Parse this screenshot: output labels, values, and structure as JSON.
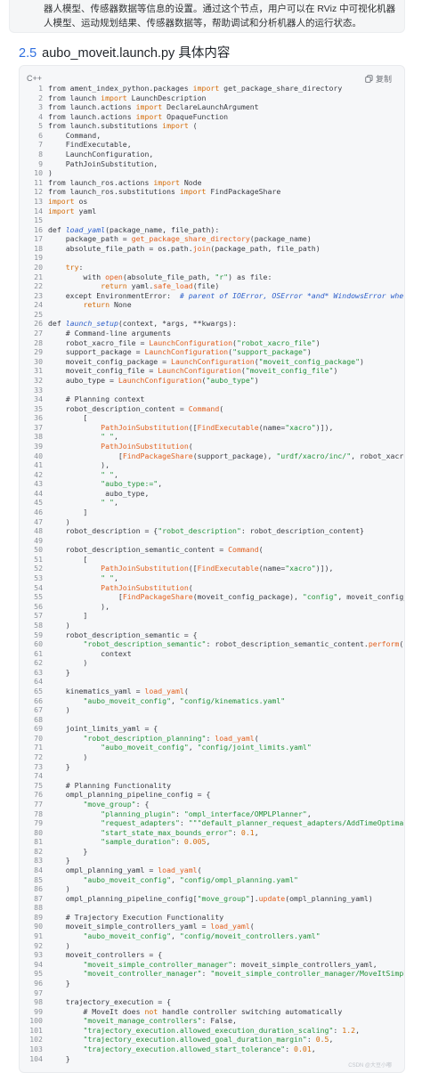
{
  "intro": {
    "text": "器人模型、传感器数据等信息的设置。通过这个节点，用户可以在 RViz 中可视化机器人模型、运动规划结果、传感器数据等，帮助调试和分析机器人的运行状态。"
  },
  "section": {
    "number": "2.5",
    "title": "aubo_moveit.launch.py 具体内容"
  },
  "code_block": {
    "language": "C++",
    "copy_label": "复制",
    "lines": [
      [
        [
          "from ament_index_python.packages ",
          ""
        ],
        [
          "import",
          "kw"
        ],
        [
          " get_package_share_directory",
          ""
        ]
      ],
      [
        [
          "from launch ",
          ""
        ],
        [
          "import",
          "kw"
        ],
        [
          " LaunchDescription",
          ""
        ]
      ],
      [
        [
          "from launch.actions ",
          ""
        ],
        [
          "import",
          "kw"
        ],
        [
          " DeclareLaunchArgument",
          ""
        ]
      ],
      [
        [
          "from launch.actions ",
          ""
        ],
        [
          "import",
          "kw"
        ],
        [
          " OpaqueFunction",
          ""
        ]
      ],
      [
        [
          "from launch.substitutions ",
          ""
        ],
        [
          "import",
          "kw"
        ],
        [
          " (",
          ""
        ]
      ],
      [
        [
          "    Command,",
          ""
        ]
      ],
      [
        [
          "    FindExecutable,",
          ""
        ]
      ],
      [
        [
          "    LaunchConfiguration,",
          ""
        ]
      ],
      [
        [
          "    PathJoinSubstitution,",
          ""
        ]
      ],
      [
        [
          ")",
          ""
        ]
      ],
      [
        [
          "from launch_ros.actions ",
          ""
        ],
        [
          "import",
          "kw"
        ],
        [
          " Node",
          ""
        ]
      ],
      [
        [
          "from launch_ros.substitutions ",
          ""
        ],
        [
          "import",
          "kw"
        ],
        [
          " FindPackageShare",
          ""
        ]
      ],
      [
        [
          "import",
          "kw"
        ],
        [
          " os",
          ""
        ]
      ],
      [
        [
          "import",
          "kw"
        ],
        [
          " yaml",
          ""
        ]
      ],
      [
        [
          "",
          ""
        ]
      ],
      [
        [
          "def ",
          ""
        ],
        [
          "load_yaml",
          "cm"
        ],
        [
          "(package_name, file_path):",
          ""
        ]
      ],
      [
        [
          "    package_path = ",
          ""
        ],
        [
          "get_package_share_directory",
          "fn"
        ],
        [
          "(package_name)",
          ""
        ]
      ],
      [
        [
          "    absolute_file_path = os.path.",
          ""
        ],
        [
          "join",
          "fn"
        ],
        [
          "(package_path, file_path)",
          ""
        ]
      ],
      [
        [
          "",
          ""
        ]
      ],
      [
        [
          "    ",
          ""
        ],
        [
          "try",
          "kw"
        ],
        [
          ":",
          ""
        ]
      ],
      [
        [
          "        with ",
          ""
        ],
        [
          "open",
          "fn"
        ],
        [
          "(absolute_file_path, ",
          ""
        ],
        [
          "\"r\"",
          "st"
        ],
        [
          ") as file:",
          ""
        ]
      ],
      [
        [
          "            ",
          ""
        ],
        [
          "return",
          "kw"
        ],
        [
          " yaml.",
          ""
        ],
        [
          "safe_load",
          "fn"
        ],
        [
          "(file)",
          ""
        ]
      ],
      [
        [
          "    except EnvironmentError:  ",
          ""
        ],
        [
          "# parent of IOError, OSError *and* WindowsError where available",
          "cm"
        ]
      ],
      [
        [
          "        ",
          ""
        ],
        [
          "return",
          "kw"
        ],
        [
          " None",
          ""
        ]
      ],
      [
        [
          "",
          ""
        ]
      ],
      [
        [
          "def ",
          ""
        ],
        [
          "launch_setup",
          "cm"
        ],
        [
          "(context, *args, **kwargs):",
          ""
        ]
      ],
      [
        [
          "    # Command-line arguments",
          ""
        ]
      ],
      [
        [
          "    robot_xacro_file = ",
          ""
        ],
        [
          "LaunchConfiguration",
          "fn"
        ],
        [
          "(",
          ""
        ],
        [
          "\"robot_xacro_file\"",
          "st"
        ],
        [
          ")",
          ""
        ]
      ],
      [
        [
          "    support_package = ",
          ""
        ],
        [
          "LaunchConfiguration",
          "fn"
        ],
        [
          "(",
          ""
        ],
        [
          "\"support_package\"",
          "st"
        ],
        [
          ")",
          ""
        ]
      ],
      [
        [
          "    moveit_config_package = ",
          ""
        ],
        [
          "LaunchConfiguration",
          "fn"
        ],
        [
          "(",
          ""
        ],
        [
          "\"moveit_config_package\"",
          "st"
        ],
        [
          ")",
          ""
        ]
      ],
      [
        [
          "    moveit_config_file = ",
          ""
        ],
        [
          "LaunchConfiguration",
          "fn"
        ],
        [
          "(",
          ""
        ],
        [
          "\"moveit_config_file\"",
          "st"
        ],
        [
          ")",
          ""
        ]
      ],
      [
        [
          "    aubo_type = ",
          ""
        ],
        [
          "LaunchConfiguration",
          "fn"
        ],
        [
          "(",
          ""
        ],
        [
          "\"aubo_type\"",
          "st"
        ],
        [
          ")",
          ""
        ]
      ],
      [
        [
          "",
          ""
        ]
      ],
      [
        [
          "    # Planning context",
          ""
        ]
      ],
      [
        [
          "    robot_description_content = ",
          ""
        ],
        [
          "Command",
          "fn"
        ],
        [
          "(",
          ""
        ]
      ],
      [
        [
          "        [",
          ""
        ]
      ],
      [
        [
          "            ",
          ""
        ],
        [
          "PathJoinSubstitution",
          "fn"
        ],
        [
          "([",
          ""
        ],
        [
          "FindExecutable",
          "fn"
        ],
        [
          "(name=",
          ""
        ],
        [
          "\"xacro\"",
          "st"
        ],
        [
          ")]),",
          ""
        ]
      ],
      [
        [
          "            ",
          ""
        ],
        [
          "\" \"",
          "st"
        ],
        [
          ",",
          ""
        ]
      ],
      [
        [
          "            ",
          ""
        ],
        [
          "PathJoinSubstitution",
          "fn"
        ],
        [
          "(",
          ""
        ]
      ],
      [
        [
          "                [",
          ""
        ],
        [
          "FindPackageShare",
          "fn"
        ],
        [
          "(support_package), ",
          ""
        ],
        [
          "\"urdf/xacro/inc/\"",
          "st"
        ],
        [
          ", robot_xacro_file]",
          ""
        ]
      ],
      [
        [
          "            ),",
          ""
        ]
      ],
      [
        [
          "            ",
          ""
        ],
        [
          "\" \"",
          "st"
        ],
        [
          ",",
          ""
        ]
      ],
      [
        [
          "            ",
          ""
        ],
        [
          "\"aubo_type:=\"",
          "st"
        ],
        [
          ",",
          ""
        ]
      ],
      [
        [
          "             aubo_type,",
          ""
        ]
      ],
      [
        [
          "            ",
          ""
        ],
        [
          "\" \"",
          "st"
        ],
        [
          ",",
          ""
        ]
      ],
      [
        [
          "        ]",
          ""
        ]
      ],
      [
        [
          "    )",
          ""
        ]
      ],
      [
        [
          "    robot_description = {",
          ""
        ],
        [
          "\"robot_description\"",
          "st"
        ],
        [
          ": robot_description_content}",
          ""
        ]
      ],
      [
        [
          "",
          ""
        ]
      ],
      [
        [
          "    robot_description_semantic_content = ",
          ""
        ],
        [
          "Command",
          "fn"
        ],
        [
          "(",
          ""
        ]
      ],
      [
        [
          "        [",
          ""
        ]
      ],
      [
        [
          "            ",
          ""
        ],
        [
          "PathJoinSubstitution",
          "fn"
        ],
        [
          "([",
          ""
        ],
        [
          "FindExecutable",
          "fn"
        ],
        [
          "(name=",
          ""
        ],
        [
          "\"xacro\"",
          "st"
        ],
        [
          ")]),",
          ""
        ]
      ],
      [
        [
          "            ",
          ""
        ],
        [
          "\" \"",
          "st"
        ],
        [
          ",",
          ""
        ]
      ],
      [
        [
          "            ",
          ""
        ],
        [
          "PathJoinSubstitution",
          "fn"
        ],
        [
          "(",
          ""
        ]
      ],
      [
        [
          "                [",
          ""
        ],
        [
          "FindPackageShare",
          "fn"
        ],
        [
          "(moveit_config_package), ",
          ""
        ],
        [
          "\"config\"",
          "st"
        ],
        [
          ", moveit_config_file]",
          ""
        ]
      ],
      [
        [
          "            ),",
          ""
        ]
      ],
      [
        [
          "        ]",
          ""
        ]
      ],
      [
        [
          "    )",
          ""
        ]
      ],
      [
        [
          "    robot_description_semantic = {",
          ""
        ]
      ],
      [
        [
          "        ",
          ""
        ],
        [
          "\"robot_description_semantic\"",
          "st"
        ],
        [
          ": robot_description_semantic_content.",
          ""
        ],
        [
          "perform",
          "fn"
        ],
        [
          "(",
          ""
        ]
      ],
      [
        [
          "            context",
          ""
        ]
      ],
      [
        [
          "        )",
          ""
        ]
      ],
      [
        [
          "    }",
          ""
        ]
      ],
      [
        [
          "",
          ""
        ]
      ],
      [
        [
          "    kinematics_yaml = ",
          ""
        ],
        [
          "load_yaml",
          "fn"
        ],
        [
          "(",
          ""
        ]
      ],
      [
        [
          "        ",
          ""
        ],
        [
          "\"aubo_moveit_config\"",
          "st"
        ],
        [
          ", ",
          ""
        ],
        [
          "\"config/kinematics.yaml\"",
          "st"
        ]
      ],
      [
        [
          "    )",
          ""
        ]
      ],
      [
        [
          "",
          ""
        ]
      ],
      [
        [
          "    joint_limits_yaml = {",
          ""
        ]
      ],
      [
        [
          "        ",
          ""
        ],
        [
          "\"robot_description_planning\"",
          "st"
        ],
        [
          ": ",
          ""
        ],
        [
          "load_yaml",
          "fn"
        ],
        [
          "(",
          ""
        ]
      ],
      [
        [
          "            ",
          ""
        ],
        [
          "\"aubo_moveit_config\"",
          "st"
        ],
        [
          ", ",
          ""
        ],
        [
          "\"config/joint_limits.yaml\"",
          "st"
        ]
      ],
      [
        [
          "        )",
          ""
        ]
      ],
      [
        [
          "    }",
          ""
        ]
      ],
      [
        [
          "",
          ""
        ]
      ],
      [
        [
          "    # Planning Functionality",
          ""
        ]
      ],
      [
        [
          "    ompl_planning_pipeline_config = {",
          ""
        ]
      ],
      [
        [
          "        ",
          ""
        ],
        [
          "\"move_group\"",
          "st"
        ],
        [
          ": {",
          ""
        ]
      ],
      [
        [
          "            ",
          ""
        ],
        [
          "\"planning_plugin\"",
          "st"
        ],
        [
          ": ",
          ""
        ],
        [
          "\"ompl_interface/OMPLPlanner\"",
          "st"
        ],
        [
          ",",
          ""
        ]
      ],
      [
        [
          "            ",
          ""
        ],
        [
          "\"request_adapters\"",
          "st"
        ],
        [
          ": ",
          ""
        ],
        [
          "\"\"\"default_planner_request_adapters/AddTimeOptimalParameterizat",
          "st"
        ]
      ],
      [
        [
          "            ",
          ""
        ],
        [
          "\"start_state_max_bounds_error\"",
          "st"
        ],
        [
          ": ",
          ""
        ],
        [
          "0.1",
          "nu"
        ],
        [
          ",",
          ""
        ]
      ],
      [
        [
          "            ",
          ""
        ],
        [
          "\"sample_duration\"",
          "st"
        ],
        [
          ": ",
          ""
        ],
        [
          "0.005",
          "nu"
        ],
        [
          ",",
          ""
        ]
      ],
      [
        [
          "        }",
          ""
        ]
      ],
      [
        [
          "    }",
          ""
        ]
      ],
      [
        [
          "    ompl_planning_yaml = ",
          ""
        ],
        [
          "load_yaml",
          "fn"
        ],
        [
          "(",
          ""
        ]
      ],
      [
        [
          "        ",
          ""
        ],
        [
          "\"aubo_moveit_config\"",
          "st"
        ],
        [
          ", ",
          ""
        ],
        [
          "\"config/ompl_planning.yaml\"",
          "st"
        ]
      ],
      [
        [
          "    )",
          ""
        ]
      ],
      [
        [
          "    ompl_planning_pipeline_config[",
          ""
        ],
        [
          "\"move_group\"",
          "st"
        ],
        [
          "].",
          ""
        ],
        [
          "update",
          "fn"
        ],
        [
          "(ompl_planning_yaml)",
          ""
        ]
      ],
      [
        [
          "",
          ""
        ]
      ],
      [
        [
          "    # Trajectory Execution Functionality",
          ""
        ]
      ],
      [
        [
          "    moveit_simple_controllers_yaml = ",
          ""
        ],
        [
          "load_yaml",
          "fn"
        ],
        [
          "(",
          ""
        ]
      ],
      [
        [
          "        ",
          ""
        ],
        [
          "\"aubo_moveit_config\"",
          "st"
        ],
        [
          ", ",
          ""
        ],
        [
          "\"config/moveit_controllers.yaml\"",
          "st"
        ]
      ],
      [
        [
          "    )",
          ""
        ]
      ],
      [
        [
          "    moveit_controllers = {",
          ""
        ]
      ],
      [
        [
          "        ",
          ""
        ],
        [
          "\"moveit_simple_controller_manager\"",
          "st"
        ],
        [
          ": moveit_simple_controllers_yaml,",
          ""
        ]
      ],
      [
        [
          "        ",
          ""
        ],
        [
          "\"moveit_controller_manager\"",
          "st"
        ],
        [
          ": ",
          ""
        ],
        [
          "\"moveit_simple_controller_manager/MoveItSimpleControllerMa",
          "st"
        ]
      ],
      [
        [
          "    }",
          ""
        ]
      ],
      [
        [
          "",
          ""
        ]
      ],
      [
        [
          "    trajectory_execution = {",
          ""
        ]
      ],
      [
        [
          "        # MoveIt does ",
          ""
        ],
        [
          "not",
          "kw"
        ],
        [
          " handle controller switching automatically",
          ""
        ]
      ],
      [
        [
          "        ",
          ""
        ],
        [
          "\"moveit_manage_controllers\"",
          "st"
        ],
        [
          ": False,",
          ""
        ]
      ],
      [
        [
          "        ",
          ""
        ],
        [
          "\"trajectory_execution.allowed_execution_duration_scaling\"",
          "st"
        ],
        [
          ": ",
          ""
        ],
        [
          "1.2",
          "nu"
        ],
        [
          ",",
          ""
        ]
      ],
      [
        [
          "        ",
          ""
        ],
        [
          "\"trajectory_execution.allowed_goal_duration_margin\"",
          "st"
        ],
        [
          ": ",
          ""
        ],
        [
          "0.5",
          "nu"
        ],
        [
          ",",
          ""
        ]
      ],
      [
        [
          "        ",
          ""
        ],
        [
          "\"trajectory_execution.allowed_start_tolerance\"",
          "st"
        ],
        [
          ": ",
          ""
        ],
        [
          "0.01",
          "nu"
        ],
        [
          ",",
          ""
        ]
      ],
      [
        [
          "    }",
          ""
        ]
      ]
    ]
  },
  "watermark": "CSDN @大豆小嘟"
}
